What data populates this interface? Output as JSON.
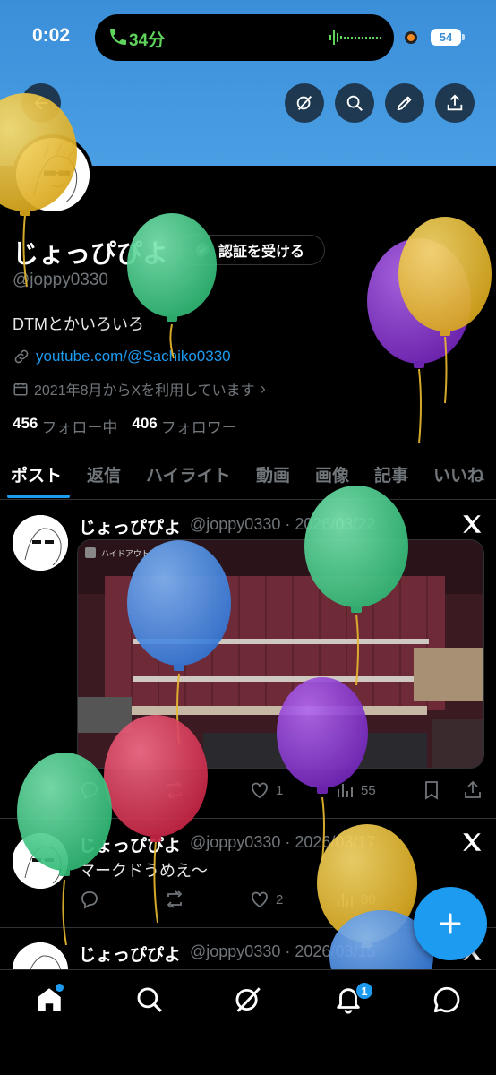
{
  "status_bar": {
    "time": "0:02",
    "call_duration": "34分",
    "battery": "54"
  },
  "header_actions": [
    "back-icon",
    "grok-icon",
    "search-icon",
    "edit-icon",
    "share-icon"
  ],
  "profile": {
    "display_name": "じょっぴぴよ",
    "verify_button": "認証を受ける",
    "handle": "@joppy0330",
    "bio": "DTMとかいろいろ",
    "link": "youtube.com/@Sachiko0330",
    "joined": "2021年8月からXを利用しています",
    "joined_chevron": "›",
    "following_count": "456",
    "following_label": "フォロー中",
    "followers_count": "406",
    "followers_label": "フォロワー"
  },
  "tabs": [
    "ポスト",
    "返信",
    "ハイライト",
    "動画",
    "画像",
    "記事",
    "いいね"
  ],
  "posts": [
    {
      "name": "じょっぴぴよ",
      "meta": "@joppy0330 · 2026/03/22",
      "media_label": "ハイドアウト",
      "reply_count": "",
      "repost_count": "",
      "like_count": "1",
      "view_count": "55"
    },
    {
      "name": "じょっぴぴよ",
      "meta": "@joppy0330 · 2026/03/17",
      "text": "マークドうめえ〜",
      "reply_count": "",
      "repost_count": "",
      "like_count": "2",
      "view_count": "80"
    },
    {
      "name": "じょっぴぴよ",
      "meta": "@joppy0330 · 2026/03/15"
    }
  ],
  "fab_icon": "plus-icon",
  "bottom_nav": {
    "items": [
      "home-icon",
      "search-icon",
      "grok-icon",
      "notifications-icon",
      "messages-icon"
    ],
    "notification_badge": "1"
  },
  "colors": {
    "accent": "#1d9bf0",
    "banner": "#4a9ee3",
    "background": "#000000",
    "muted_text": "#71767b",
    "call_green": "#5fd35b",
    "balloon_yellow": "#f2c230",
    "balloon_green": "#47d08e",
    "balloon_purple": "#8e35d6",
    "balloon_blue": "#4c8fe8",
    "balloon_red": "#e23a5b"
  }
}
